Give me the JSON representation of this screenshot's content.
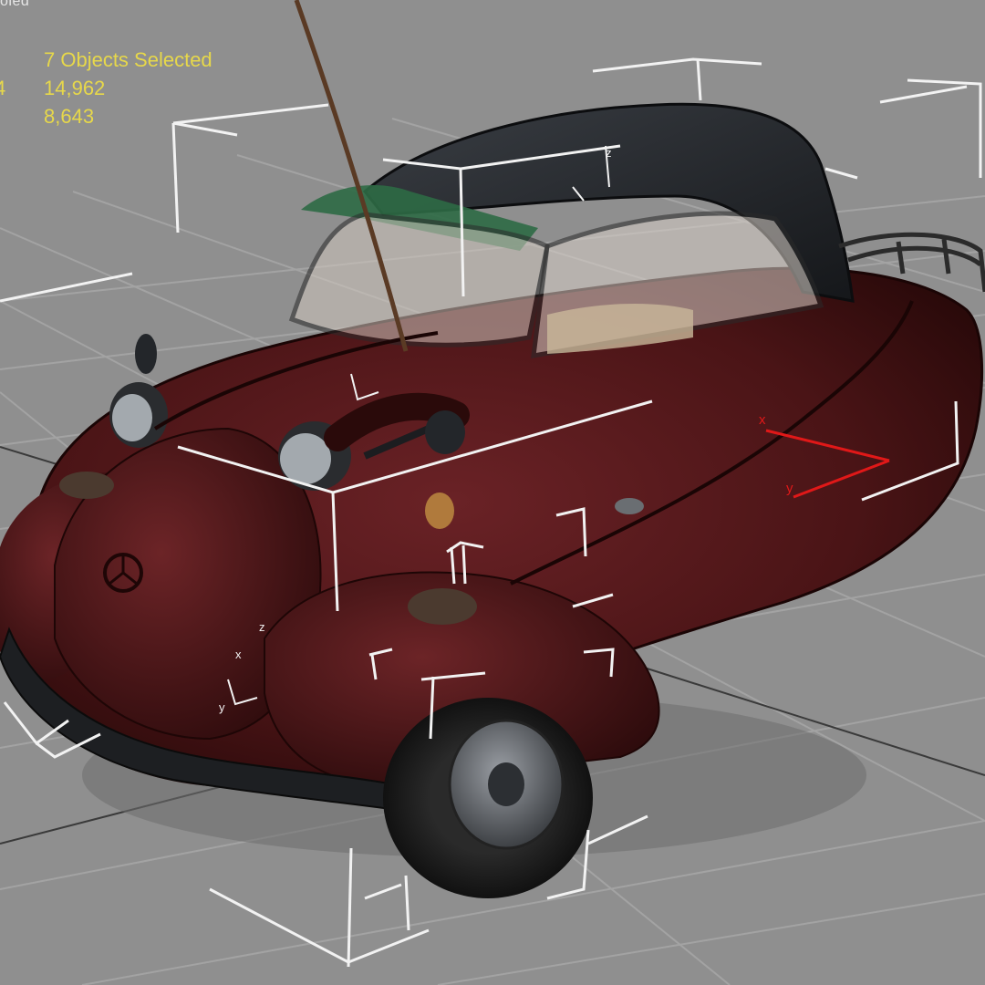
{
  "viewport": {
    "label": "oled",
    "background": "#8f8f8f",
    "grid_color": "#a3a3a3",
    "shading_mode": "smooth-shaded"
  },
  "selection_stats": {
    "rows": [
      {
        "prefix": "",
        "value": "7 Objects Selected"
      },
      {
        "prefix": "4",
        "value": "14,962"
      },
      {
        "prefix": "",
        "value": "8,643"
      }
    ],
    "text_color": "#e7d84a"
  },
  "model": {
    "name": "bubble car",
    "body_color": "#4a1416",
    "roof_color": "#23262b",
    "windshield_color": "#2e6a45"
  },
  "gizmo": {
    "x_label": "x",
    "y_label": "y",
    "z_label": "z",
    "color": "#e01818"
  }
}
